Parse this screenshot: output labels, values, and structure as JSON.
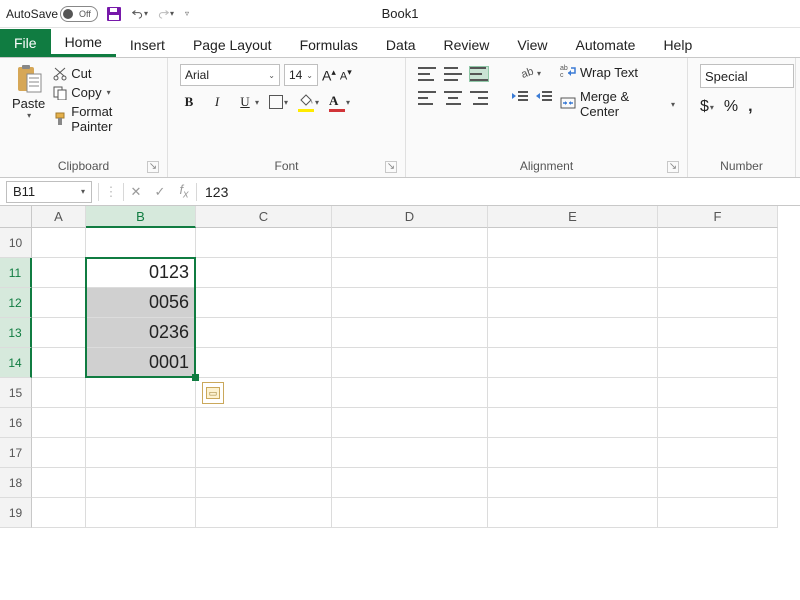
{
  "titlebar": {
    "autosave_label": "AutoSave",
    "autosave_state": "Off",
    "doc_title": "Book1"
  },
  "tabs": {
    "file": "File",
    "items": [
      "Home",
      "Insert",
      "Page Layout",
      "Formulas",
      "Data",
      "Review",
      "View",
      "Automate",
      "Help"
    ],
    "active": "Home"
  },
  "ribbon": {
    "clipboard": {
      "paste": "Paste",
      "cut": "Cut",
      "copy": "Copy",
      "format_painter": "Format Painter",
      "group_label": "Clipboard"
    },
    "font": {
      "name": "Arial",
      "size": "14",
      "group_label": "Font"
    },
    "alignment": {
      "wrap_text": "Wrap Text",
      "merge_center": "Merge & Center",
      "group_label": "Alignment"
    },
    "number": {
      "format": "Special",
      "group_label": "Number"
    }
  },
  "formula_bar": {
    "name_box": "B11",
    "formula": "123"
  },
  "grid": {
    "columns": [
      "A",
      "B",
      "C",
      "D",
      "E",
      "F"
    ],
    "row_start": 10,
    "rows": [
      "10",
      "11",
      "12",
      "13",
      "14",
      "15",
      "16",
      "17",
      "18",
      "19"
    ],
    "selected_col": "B",
    "selected_rows": [
      "11",
      "12",
      "13",
      "14"
    ],
    "cells": {
      "B11": "0123",
      "B12": "0056",
      "B13": "0236",
      "B14": "0001"
    }
  }
}
